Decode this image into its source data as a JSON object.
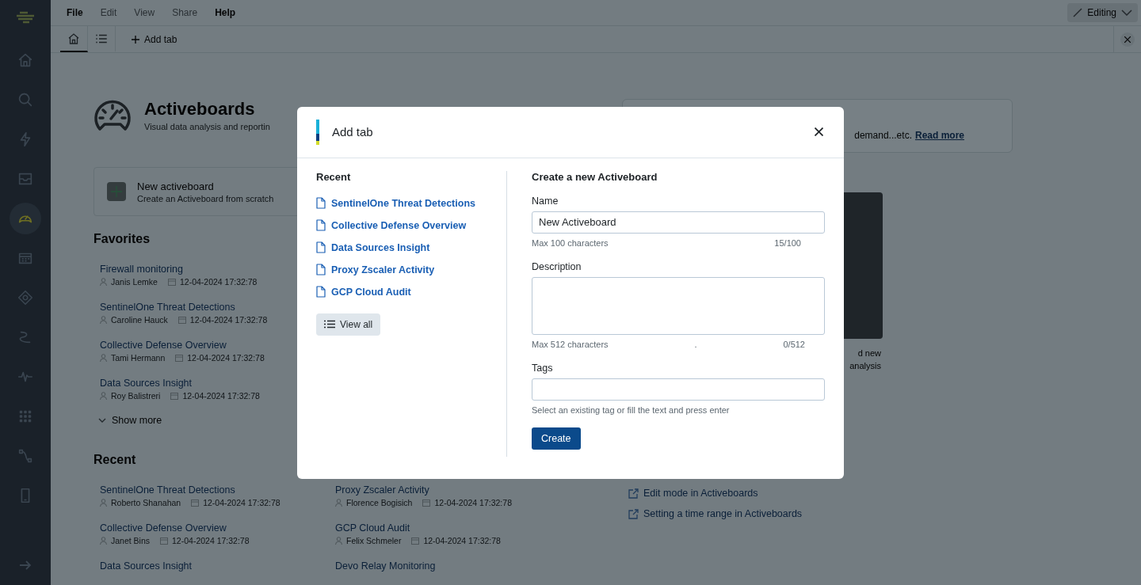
{
  "sidebar": {
    "items": [
      {
        "selected": false
      },
      {
        "selected": false
      },
      {
        "selected": false
      },
      {
        "selected": false
      },
      {
        "selected": true
      },
      {
        "selected": false
      },
      {
        "selected": false
      },
      {
        "selected": false
      },
      {
        "selected": false
      },
      {
        "selected": false
      },
      {
        "selected": false
      },
      {
        "selected": false
      }
    ]
  },
  "menu": [
    {
      "label": "File",
      "disabled": false
    },
    {
      "label": "Edit",
      "disabled": true
    },
    {
      "label": "View",
      "disabled": true
    },
    {
      "label": "Share",
      "disabled": true
    },
    {
      "label": "Help",
      "disabled": false
    }
  ],
  "mode_button": {
    "label": "Editing"
  },
  "tabs": [
    {
      "kind": "home",
      "selected": true
    },
    {
      "kind": "list",
      "selected": false
    }
  ],
  "add_tab": {
    "label": "Add tab"
  },
  "page": {
    "title": "Activeboards",
    "subtitle": "Visual data analysis and reportin",
    "new_card": {
      "title": "New activeboard",
      "subtitle": "Create an Activeboard from scratch"
    },
    "favorites": {
      "heading": "Favorites",
      "items": [
        {
          "title": "Firewall monitoring",
          "author": "Janis Lemke",
          "date": "12-04-2024 17:32:78"
        },
        {
          "title": "SentinelOne Threat Detections",
          "author": "Caroline Hauck",
          "date": "12-04-2024 17:32:78"
        },
        {
          "title": "Collective Defense Overview",
          "author": "Tami Hermann",
          "date": "12-04-2024 17:32:78"
        },
        {
          "title": "Data Sources Insight",
          "author": "Roy Balistreri",
          "date": "12-04-2024 17:32:78"
        }
      ],
      "show_more": "Show more"
    },
    "recent": {
      "heading": "Recent",
      "items": [
        {
          "title": "SentinelOne Threat Detections",
          "author": "Roberto Shanahan",
          "date": "12-04-2024 17:32:78"
        },
        {
          "title": "Proxy Zscaler Activity",
          "author": "Florence Bogisich",
          "date": "12-04-2024 17:32:78"
        },
        {
          "title": "Collective Defense Overview",
          "author": "Janet Bins",
          "date": "12-04-2024 17:32:78"
        },
        {
          "title": "GCP Cloud Audit",
          "author": "Felix Schmeler",
          "date": "12-04-2024 17:32:78"
        },
        {
          "title": "Data Sources Insight"
        },
        {
          "title": "Devo Relay Monitoring"
        }
      ]
    },
    "info": {
      "text": "demand...etc.",
      "link": "Read more"
    },
    "video_caption": [
      "d new",
      "analysis"
    ],
    "help_links": [
      {
        "label": "Edit mode in Activeboards"
      },
      {
        "label": "Setting a time range in Activeboards"
      }
    ]
  },
  "dialog": {
    "title": "Add tab",
    "recent": {
      "heading": "Recent",
      "items": [
        {
          "label": "SentinelOne Threat Detections"
        },
        {
          "label": "Collective Defense Overview"
        },
        {
          "label": "Data Sources Insight"
        },
        {
          "label": "Proxy Zscaler Activity"
        },
        {
          "label": "GCP Cloud Audit"
        }
      ],
      "view_all": "View all"
    },
    "form": {
      "heading": "Create a new Activeboard",
      "name": {
        "label": "Name",
        "value": "New Activeboard",
        "hint": "Max 100 characters",
        "count": "15/100"
      },
      "description": {
        "label": "Description",
        "hint": "Max 512 characters",
        "mark": ".",
        "count": "0/512"
      },
      "tags": {
        "label": "Tags",
        "hint": "Select an existing tag or fill the text and press enter"
      },
      "submit": "Create"
    }
  }
}
